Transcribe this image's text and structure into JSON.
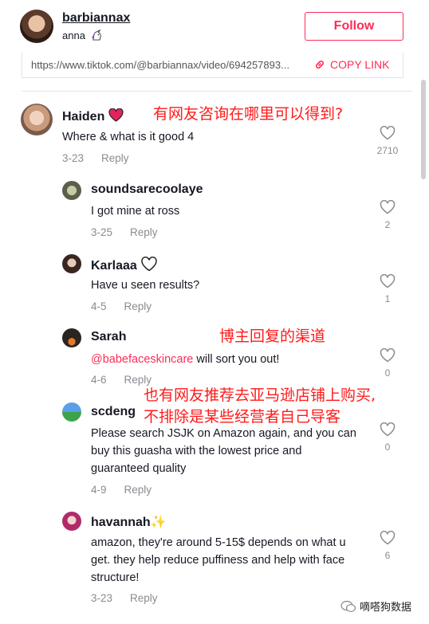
{
  "author": {
    "username": "barbiannax",
    "nickname": "anna",
    "follow_label": "Follow"
  },
  "share": {
    "url": "https://www.tiktok.com/@barbiannax/video/694257893...",
    "copy_label": "COPY LINK"
  },
  "comments": [
    {
      "name": "Haiden",
      "text": "Where & what is it good 4",
      "date": "3-23",
      "reply": "Reply",
      "likes": "2710"
    },
    {
      "name": "soundsarecoolaye",
      "text": "I got mine at ross",
      "date": "3-25",
      "reply": "Reply",
      "likes": "2"
    },
    {
      "name": "Karlaaa",
      "text": "Have u seen results?",
      "date": "4-5",
      "reply": "Reply",
      "likes": "1"
    },
    {
      "name": "Sarah",
      "mention": "@babefaceskincare",
      "text": " will sort you out!",
      "date": "4-6",
      "reply": "Reply",
      "likes": "0"
    },
    {
      "name": "scdeng",
      "text": "Please search JSJK on Amazon again, and you can buy this guasha with the lowest price and guaranteed quality",
      "date": "4-9",
      "reply": "Reply",
      "likes": "0"
    },
    {
      "name": "havannah✨",
      "text": "amazon, they're around 5-15$ depends on what u get. they help reduce puffiness and help with face structure!",
      "date": "3-23",
      "reply": "Reply",
      "likes": "6"
    }
  ],
  "annotations": {
    "a1": "有网友咨询在哪里可以得到?",
    "a2": "博主回复的渠道",
    "a3_line1": "也有网友推荐去亚马逊店铺上购买,",
    "a3_line2": "不排除是某些经营者自己导客"
  },
  "watermark": "嘀嗒狗数据",
  "colors": {
    "accent": "#fe2c55",
    "annotation": "#ff1a1a",
    "meta": "#8a8b91"
  }
}
